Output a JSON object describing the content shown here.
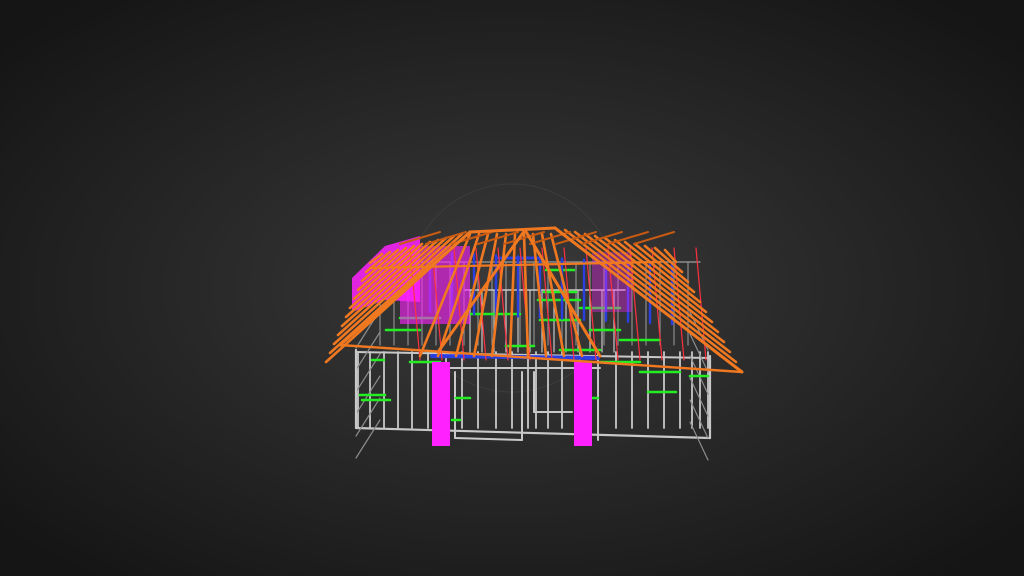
{
  "scene": {
    "background_center": "#3a3a3a",
    "background_edge": "#161616",
    "loading_ring": "#4a4a4a",
    "colors": {
      "wall_frame": "#c8c8c8",
      "wall_frame_dark": "#8c8c8c",
      "noggin": "#22ee22",
      "lintel": "#2b3fe0",
      "panel": "#ff22ff",
      "rafter": "#f07820",
      "rafter_dark": "#c85a12",
      "web_member": "#ff3040"
    }
  }
}
